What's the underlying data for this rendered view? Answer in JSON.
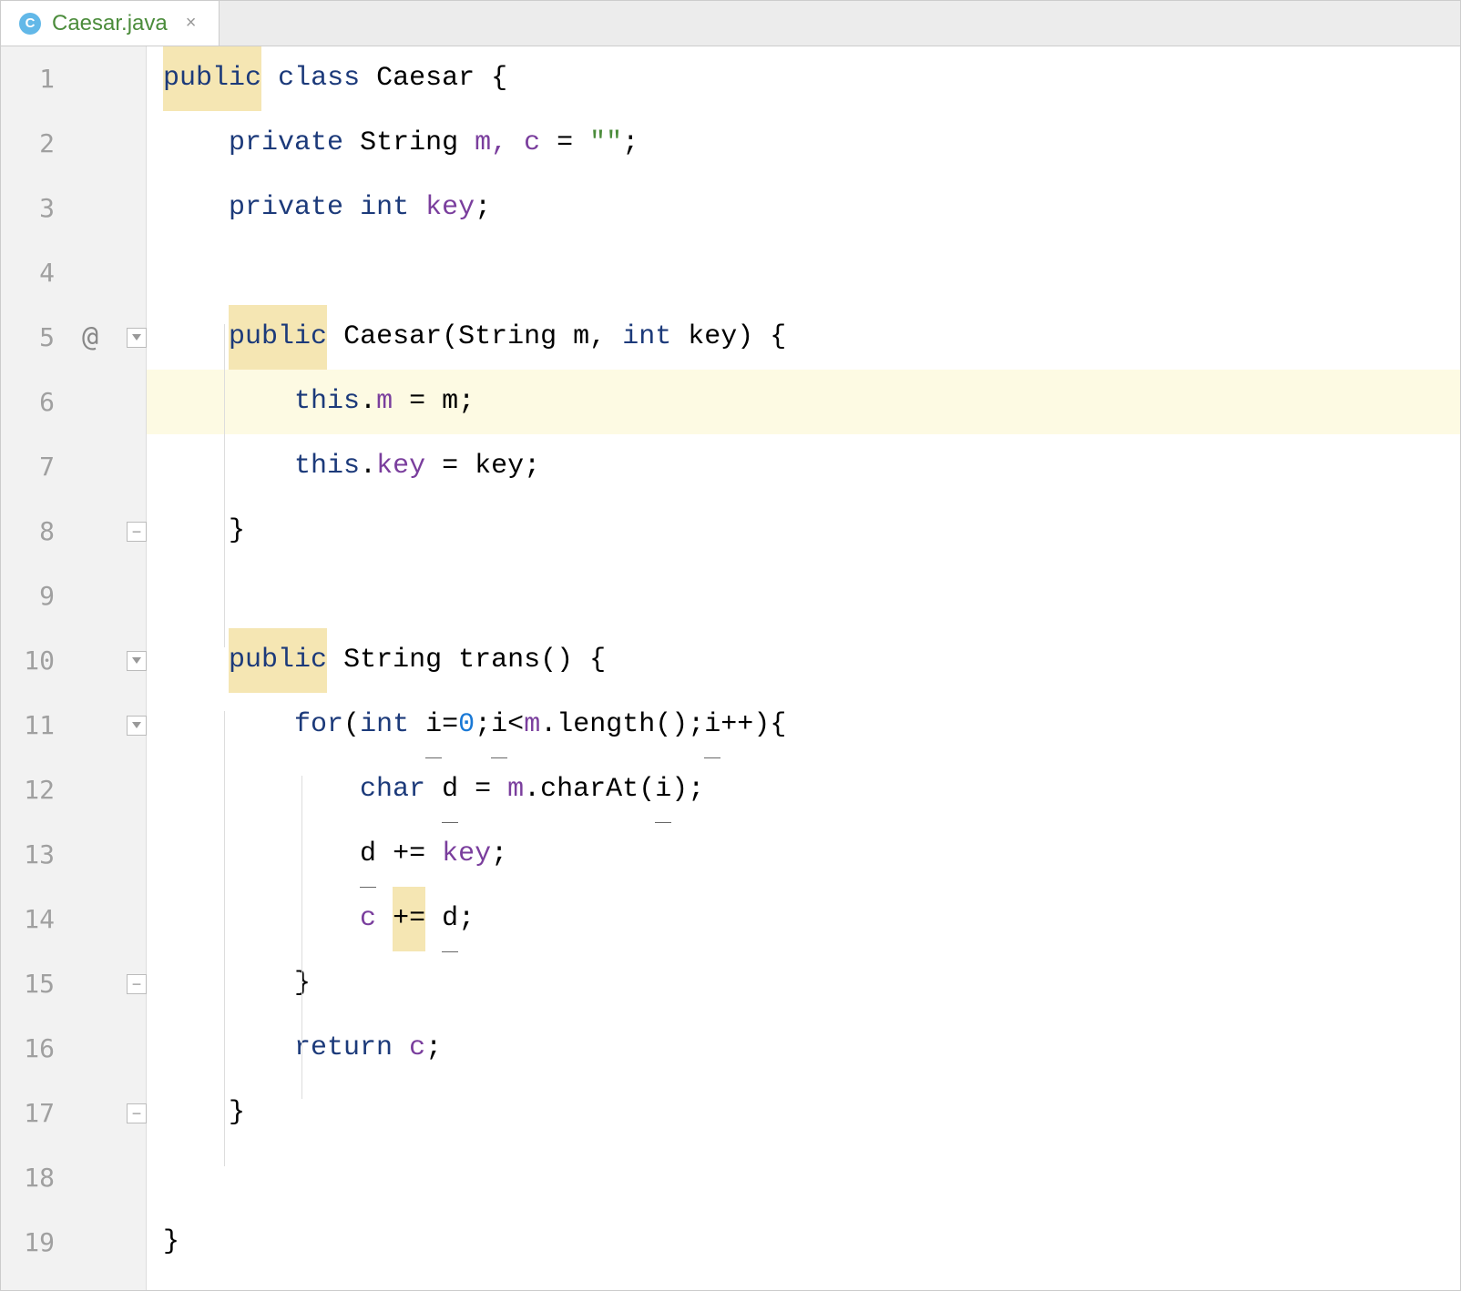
{
  "tab": {
    "filename": "Caesar.java",
    "icon_letter": "C",
    "close": "×"
  },
  "gutter": {
    "lines": [
      "1",
      "2",
      "3",
      "4",
      "5",
      "6",
      "7",
      "8",
      "9",
      "10",
      "11",
      "12",
      "13",
      "14",
      "15",
      "16",
      "17",
      "18",
      "19"
    ],
    "annotation_at": "@"
  },
  "code": {
    "line1": {
      "kw_public": "public",
      "kw_class": "class",
      "name": "Caesar",
      "brace": "{"
    },
    "line2": {
      "kw_private": "private",
      "type": "String",
      "vars": "m, c",
      "eq": "=",
      "str": "\"\"",
      "semi": ";"
    },
    "line3": {
      "kw_private": "private",
      "kw_int": "int",
      "name": "key",
      "semi": ";"
    },
    "line5": {
      "kw_public": "public",
      "name": "Caesar",
      "paren_open": "(",
      "type_s": "String",
      "param1": "m",
      "comma": ", ",
      "kw_int": "int",
      "param2": "key",
      "paren_close": ")",
      "brace": "{"
    },
    "line6": {
      "kw_this": "this",
      "dot": ".",
      "field": "m",
      "eq": "=",
      "rhs": "m",
      "semi": ";"
    },
    "line7": {
      "kw_this": "this",
      "dot": ".",
      "field": "key",
      "eq": "=",
      "rhs": "key",
      "semi": ";"
    },
    "line8": {
      "brace": "}"
    },
    "line10": {
      "kw_public": "public",
      "type": "String",
      "name": "trans",
      "parens": "()",
      "brace": "{"
    },
    "line11": {
      "kw_for": "for",
      "paren_open": "(",
      "kw_int": "int",
      "var_i": "i",
      "eq": "=",
      "zero": "0",
      "semi1": ";",
      "cond_i": "i",
      "lt": "<",
      "m": "m",
      "dot": ".",
      "length": "length",
      "parens": "()",
      "semi2": ";",
      "inc_i": "i",
      "inc": "++",
      "paren_close": ")",
      "brace": "{"
    },
    "line12": {
      "kw_char": "char",
      "var_d": "d",
      "eq": "=",
      "m": "m",
      "dot": ".",
      "method": "charAt",
      "paren_open": "(",
      "arg_i": "i",
      "paren_close": ")",
      "semi": ";"
    },
    "line13": {
      "var_d": "d",
      "op": "+=",
      "field": "key",
      "semi": ";"
    },
    "line14": {
      "c": "c",
      "op": "+=",
      "var_d": "d",
      "semi": ";"
    },
    "line15": {
      "brace": "}"
    },
    "line16": {
      "kw_return": "return",
      "c": "c",
      "semi": ";"
    },
    "line17": {
      "brace": "}"
    },
    "line19": {
      "brace": "}"
    }
  }
}
